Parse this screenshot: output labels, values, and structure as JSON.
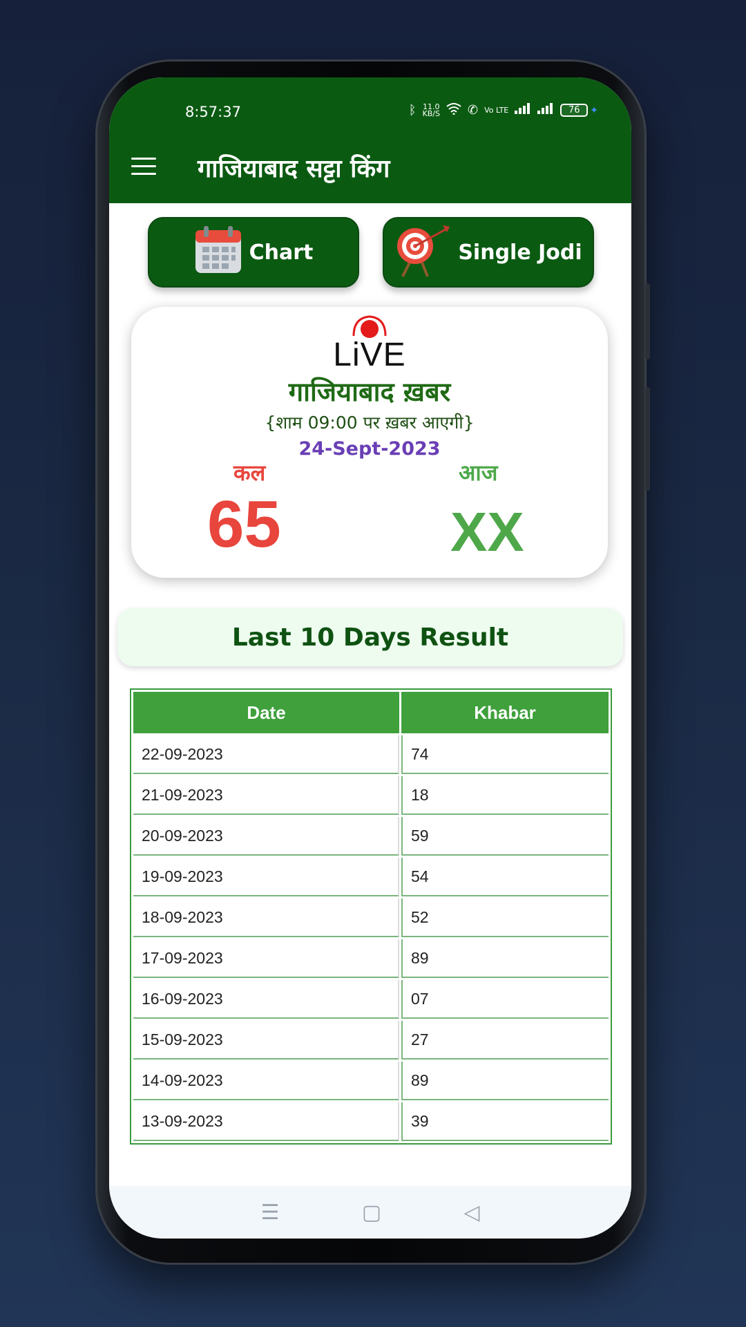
{
  "status_bar": {
    "time": "8:57:37",
    "speed": "11.0",
    "speed_unit": "KB/S",
    "volte": "Vo LTE",
    "battery": "76",
    "icons": [
      "bluetooth-icon",
      "wifi-icon",
      "call-icon",
      "signal-icon",
      "signal-icon",
      "battery-icon",
      "charging-icon"
    ]
  },
  "app_bar": {
    "title": "गाजियाबाद सट्टा किंग",
    "menu_icon": "hamburger-menu-icon"
  },
  "actions": {
    "chart_label": "Chart",
    "chart_icon": "calendar-icon",
    "jodi_label": "Single Jodi",
    "jodi_icon": "target-icon"
  },
  "live_card": {
    "badge": "LiVE",
    "headline": "गाजियाबाद  ख़बर",
    "subtitle": "{शाम 09:00 पर ख़बर आएगी}",
    "date": "24-Sept-2023",
    "yesterday_label": "कल",
    "yesterday_value": "65",
    "today_label": "आज",
    "today_value": "XX"
  },
  "results": {
    "title": "Last 10 Days Result",
    "columns": [
      "Date",
      "Khabar"
    ],
    "rows": [
      [
        "22-09-2023",
        "74"
      ],
      [
        "21-09-2023",
        "18"
      ],
      [
        "20-09-2023",
        "59"
      ],
      [
        "19-09-2023",
        "54"
      ],
      [
        "18-09-2023",
        "52"
      ],
      [
        "17-09-2023",
        "89"
      ],
      [
        "16-09-2023",
        "07"
      ],
      [
        "15-09-2023",
        "27"
      ],
      [
        "14-09-2023",
        "89"
      ],
      [
        "13-09-2023",
        "39"
      ]
    ]
  },
  "nav_bar": {
    "menu_glyph": "☰",
    "home_glyph": "▢",
    "back_glyph": "◁"
  },
  "colors": {
    "primary_green": "#0b5a12",
    "table_header_green": "#3fa03c",
    "red": "#e8453c",
    "light_green": "#4ea84a",
    "date_purple": "#6a3fb5"
  }
}
